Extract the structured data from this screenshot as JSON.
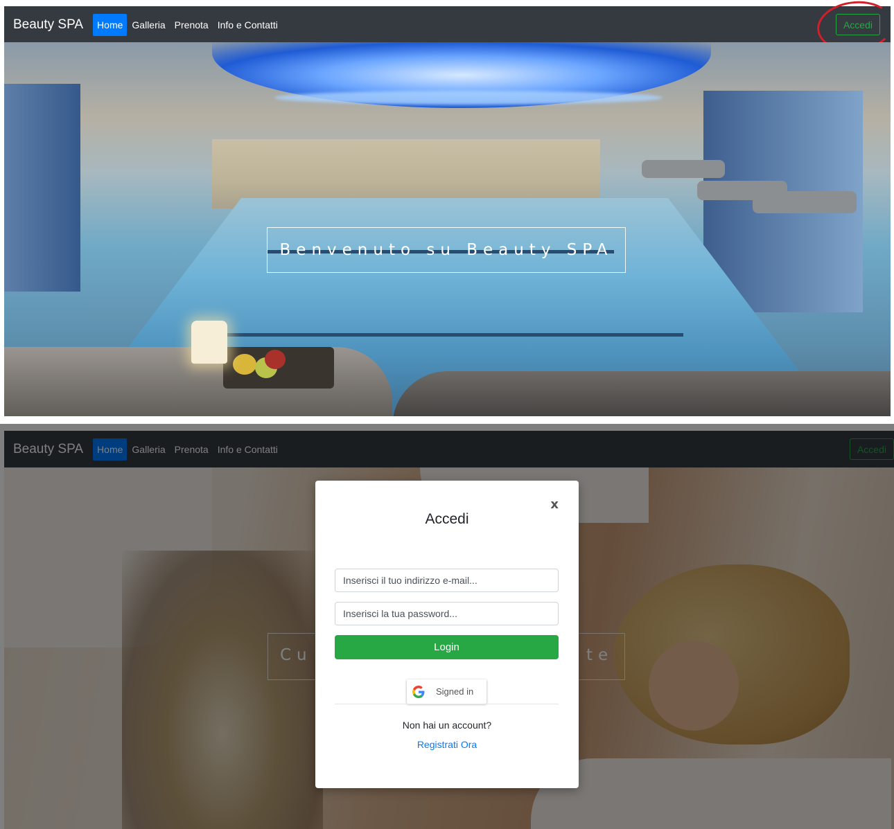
{
  "navbar": {
    "brand": "Beauty SPA",
    "items": [
      {
        "label": "Home",
        "active": true
      },
      {
        "label": "Galleria",
        "active": false
      },
      {
        "label": "Prenota",
        "active": false
      },
      {
        "label": "Info e Contatti",
        "active": false
      }
    ],
    "login_button": "Accedi"
  },
  "hero": {
    "welcome_text": "Benvenuto su Beauty SPA"
  },
  "background_caption": {
    "visible_left": "Cu",
    "visible_right": "te"
  },
  "modal": {
    "title": "Accedi",
    "close_label": "x",
    "email_placeholder": "Inserisci il tuo indirizzo e-mail...",
    "password_placeholder": "Inserisci la tua password...",
    "login_button": "Login",
    "google_button": "Signed in",
    "no_account_text": "Non hai un account?",
    "register_link": "Registrati Ora"
  },
  "colors": {
    "navbar_bg": "#343a40",
    "active_tab": "#007bff",
    "accent_green": "#28a745",
    "link_blue": "#007bff",
    "annotation_red": "#d21f2a"
  }
}
